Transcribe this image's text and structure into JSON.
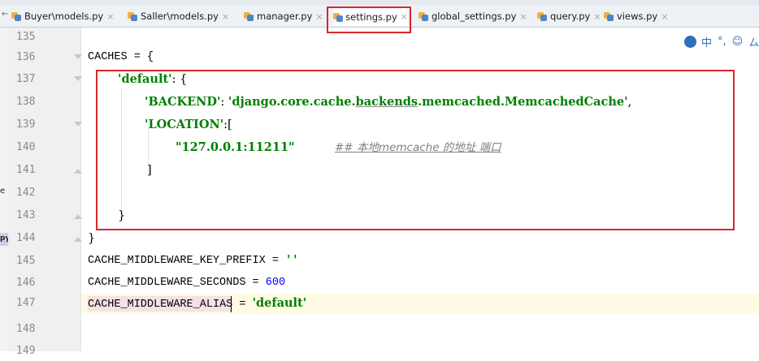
{
  "tabs": [
    {
      "label": "Buyer\\models.py",
      "active": false
    },
    {
      "label": "Saller\\models.py",
      "active": false
    },
    {
      "label": "manager.py",
      "active": false
    },
    {
      "label": "settings.py",
      "active": true
    },
    {
      "label": "global_settings.py",
      "active": false
    },
    {
      "label": "query.py",
      "active": false
    },
    {
      "label": "views.py",
      "active": false
    }
  ],
  "close_glyph": "×",
  "ime_toolbar": {
    "chinese_label": "中",
    "punct_label": "°,",
    "emoji_label": "☺",
    "more_label": "ㄙ"
  },
  "left_panel": {
    "fragment_top": "e",
    "fragment_bottom": "py"
  },
  "editor": {
    "lines": [
      {
        "number": "135",
        "text": ""
      },
      {
        "number": "136",
        "text": "CACHES = {"
      },
      {
        "number": "137",
        "key": "'default'",
        "rest": ": {"
      },
      {
        "number": "138",
        "key": "'BACKEND'",
        "sep": ": ",
        "pre": "'django.core.cache.",
        "mid": "backends",
        "post": ".memcached.MemcachedCache'",
        "end": ","
      },
      {
        "number": "139",
        "key": "'LOCATION'",
        "rest": ":["
      },
      {
        "number": "140",
        "value": "\"127.0.0.1:11211\"",
        "comment": "## 本地memcache 的地址 端口"
      },
      {
        "number": "141",
        "text": "]"
      },
      {
        "number": "142",
        "text": ""
      },
      {
        "number": "143",
        "text": "}"
      },
      {
        "number": "144",
        "text": "}"
      },
      {
        "number": "145",
        "name": "CACHE_MIDDLEWARE_KEY_PREFIX",
        "op": " = ",
        "value": "''"
      },
      {
        "number": "146",
        "name": "CACHE_MIDDLEWARE_SECONDS",
        "op": " = ",
        "value": "600"
      },
      {
        "number": "147",
        "name_pre": "CACHE_MIDDLEWARE_AL",
        "name_post": "IAS",
        "op": " = ",
        "value": "'default'"
      },
      {
        "number": "148",
        "text": ""
      },
      {
        "number": "149",
        "text": ""
      }
    ]
  },
  "colors": {
    "highlight": "#d9262a",
    "string": "#008000",
    "number": "#0000ff",
    "comment": "#808080"
  }
}
